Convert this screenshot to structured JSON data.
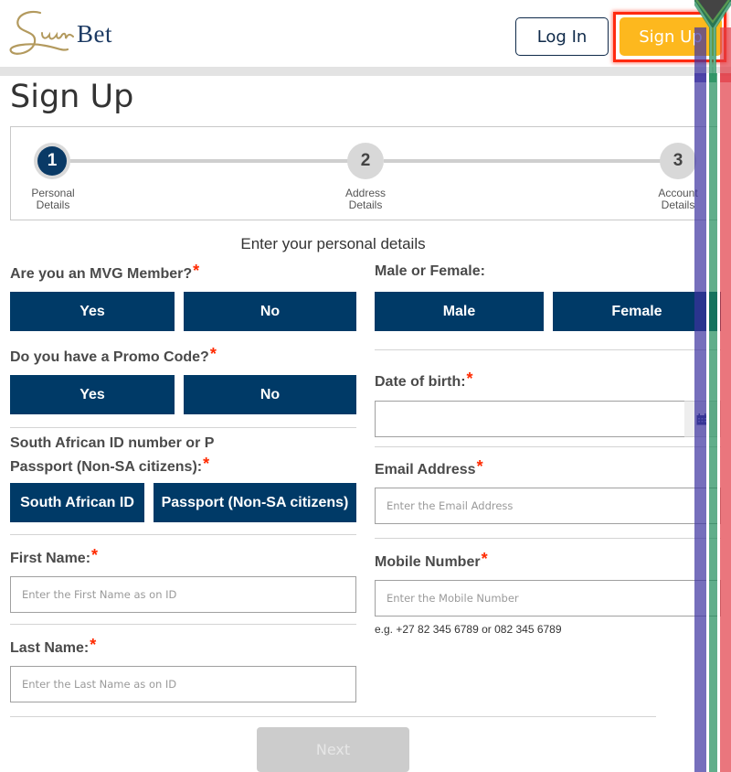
{
  "header": {
    "logo_script": "Sun",
    "logo_text": "Bet",
    "login_label": "Log In",
    "signup_label": "Sign Up"
  },
  "page": {
    "title": "Sign Up"
  },
  "stepper": {
    "current_step": 1,
    "steps": [
      {
        "number": "1",
        "label_line1": "Personal",
        "label_line2": "Details"
      },
      {
        "number": "2",
        "label_line1": "Address",
        "label_line2": "Details"
      },
      {
        "number": "3",
        "label_line1": "Account",
        "label_line2": "Details"
      }
    ]
  },
  "form": {
    "heading": "Enter your personal details",
    "required_marker": "*",
    "mvg": {
      "label": "Are you an MVG Member?",
      "yes": "Yes",
      "no": "No"
    },
    "promo": {
      "label": "Do you have a Promo Code?",
      "yes": "Yes",
      "no": "No"
    },
    "id_type": {
      "label_line1": "South African ID number or P",
      "label_line2": "Passport (Non-SA citizens):",
      "option_sa": "South African ID",
      "option_passport": "Passport (Non-SA citizens)"
    },
    "first_name": {
      "label": "First Name:",
      "placeholder": "Enter the First Name as on ID",
      "value": ""
    },
    "last_name": {
      "label": "Last Name:",
      "placeholder": "Enter the Last Name as on ID",
      "value": ""
    },
    "gender": {
      "label": "Male or Female:",
      "male": "Male",
      "female": "Female"
    },
    "dob": {
      "label": "Date of birth:",
      "value": "",
      "icon": "calendar-icon"
    },
    "email": {
      "label": "Email Address",
      "placeholder": "Enter the Email Address",
      "value": ""
    },
    "mobile": {
      "label": "Mobile Number",
      "placeholder": "Enter the Mobile Number",
      "value": "",
      "hint": "e.g. +27 82 345 6789 or 082 345 6789"
    },
    "next_label": "Next"
  },
  "colors": {
    "primary_navy": "#003a67",
    "accent_yellow": "#fdb81e",
    "required_red": "#ff2a00",
    "disabled_gray": "#cccccc"
  }
}
